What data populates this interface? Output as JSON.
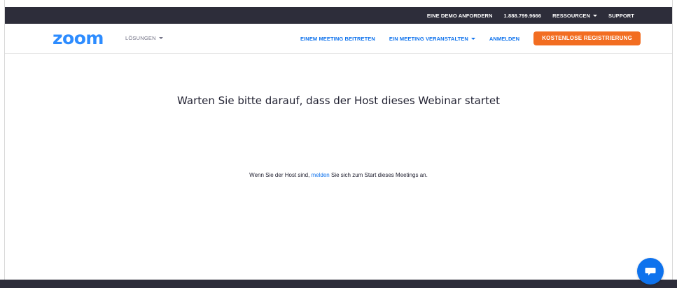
{
  "topbar": {
    "demo": "EINE DEMO ANFORDERN",
    "phone": "1.888.799.9666",
    "resources": "RESSOURCEN",
    "support": "SUPPORT"
  },
  "nav": {
    "logo": "zoom",
    "solutions": "LÖSUNGEN",
    "join": "EINEM MEETING BEITRETEN",
    "host": "EIN MEETING VERANSTALTEN",
    "signin": "ANMELDEN",
    "signup": "KOSTENLOSE REGISTRIERUNG"
  },
  "main": {
    "headline": "Warten Sie bitte darauf, dass der Host dieses Webinar startet",
    "host_prefix": "Wenn Sie der Host sind, ",
    "host_link": "melden",
    "host_suffix": " Sie sich zum Start dieses Meetings an."
  },
  "icons": {
    "chat": "chat-bubble-icon"
  },
  "colors": {
    "brand_blue": "#2d8cff",
    "link_blue": "#0e72ed",
    "signup_orange": "#f26d21",
    "dark_bar": "#2d2d3a"
  }
}
